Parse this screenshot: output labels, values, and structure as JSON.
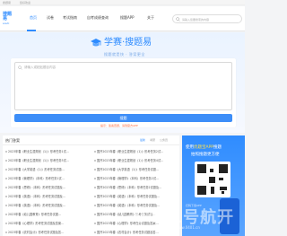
{
  "topstrip": {
    "left": "搜题易",
    "right": "您好欢迎"
  },
  "logo": {
    "main": "搜题易",
    "sub": "souti"
  },
  "nav": {
    "items": [
      {
        "label": "首页",
        "active": true
      },
      {
        "label": "试卷",
        "active": false
      },
      {
        "label": "考试指南",
        "active": false
      },
      {
        "label": "自考成绩查询",
        "active": false
      },
      {
        "label": "搜题APP",
        "active": false
      },
      {
        "label": "关于",
        "active": false
      }
    ]
  },
  "header_search": {
    "placeholder": "请输入您要搜索的内容"
  },
  "brand": {
    "name": "学赛·搜题易",
    "slogan": "搜题就是快 · 答案更全"
  },
  "search": {
    "placeholder": "请输入或粘贴题目内容",
    "button": "搜题",
    "hint": "提示：答案查题，请到官方APP"
  },
  "section": {
    "title": "热门答案",
    "tabs": [
      "最新",
      "考研",
      "公务员"
    ]
  },
  "list": [
    {
      "left": "2023年春《职业生涯规划（1）》形考任务1试…",
      "right": "国开2023年春《职业生涯规划（1）》形考任务2试…"
    },
    {
      "left": "2023年春《职业生涯规划（1）》形考任务3试…",
      "right": "国开2023年春《职业生涯规划（1）》形考任务4试…"
    },
    {
      "left": "2023年春《大学英语（1）》形考任务试题…",
      "right": "国开2023年春《大学英语（1）》形考任务试题…"
    },
    {
      "left": "2023年春《管理学》（本科）形考任务1试…",
      "right": "国开2023年春《管理学》（本科）形考任务2试…"
    },
    {
      "left": "2023年春《思修》（本科）形考任务试题及…",
      "right": "国开2023年春《思修》（本科）形考任务2试题及…"
    },
    {
      "left": "2023年春《英语》（本科）形考任务试题及…",
      "right": "国开2023年春《英语》（本科）形考任务试题及…"
    },
    {
      "left": "2023年春《英语》（本科）形考任务试题及…",
      "right": "国开2023年春《英语》（本科）形考任务试题及…"
    },
    {
      "left": "2023年春《幼儿园教育》形考任务试题…",
      "right": "国开2023年春《幼儿园教育》形考任务试题…"
    },
    {
      "left": "2023年春《心理学》形考任务试题及答案…",
      "right": "国开2023年春《心理学》形考任务试题及答案…"
    },
    {
      "left": "2023年春《农村会计》形考任务试题及答…",
      "right": "国开2023年春《农村会计》形考任务试题及答…"
    }
  ],
  "ad": {
    "line1_prefix": "使用",
    "line1_highlight": "优题宝APP",
    "line1_suffix": "搜题",
    "line2": "拍照搜题更方便",
    "caption": "扫码下载APP"
  },
  "watermark": {
    "main": "0401号航开",
    "sub": "www.0401.cn"
  },
  "colors": {
    "accent": "#2f8cff",
    "button": "#3d8ef8",
    "hint": "#ff6a3d"
  }
}
